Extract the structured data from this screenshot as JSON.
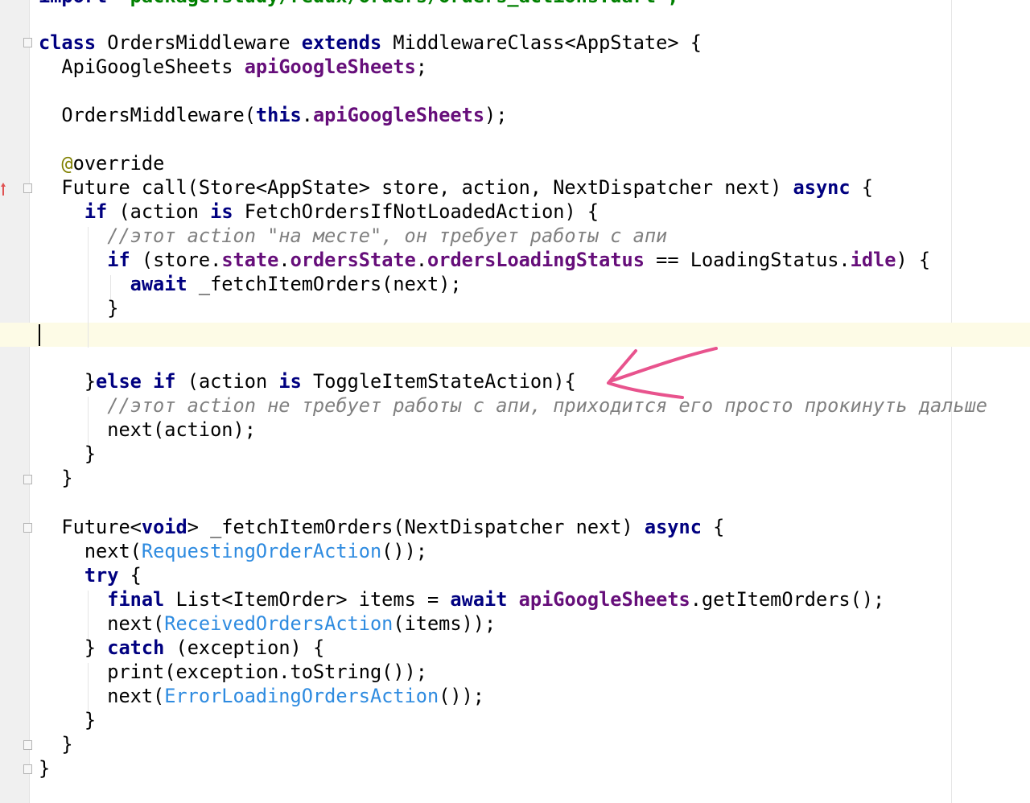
{
  "editor": {
    "lines": [
      [
        "import",
        "'package:study/redux/orders/orders_actions.dart';"
      ],
      [
        "class",
        "OrdersMiddleware",
        "extends",
        "MiddlewareClass<AppState> {"
      ],
      [
        "ApiGoogleSheets",
        "apiGoogleSheets",
        ";"
      ],
      [
        "OrdersMiddleware(",
        "this",
        ".",
        "apiGoogleSheets",
        ");"
      ],
      [
        "@",
        "override"
      ],
      [
        "Future call(Store<AppState> store, action, NextDispatcher next)",
        "async",
        "{"
      ],
      [
        "if",
        "(action",
        "is",
        "FetchOrdersIfNotLoadedAction) {"
      ],
      [
        "//этот action \"на месте\", он требует работы с апи"
      ],
      [
        "if",
        "(store.",
        "state",
        ".",
        "ordersState",
        ".",
        "ordersLoadingStatus",
        "== LoadingStatus.",
        "idle",
        ") {"
      ],
      [
        "await",
        "_fetchItemOrders(next);"
      ],
      [
        "}"
      ],
      [
        "}",
        "else",
        "if",
        "(action",
        "is",
        "ToggleItemStateAction){"
      ],
      [
        "//этот action не требует работы с апи, приходится его просто прокинуть дальше"
      ],
      [
        "next(action);"
      ],
      [
        "}"
      ],
      [
        "}"
      ],
      [
        "Future<",
        "void",
        "> _fetchItemOrders(NextDispatcher next)",
        "async",
        "{"
      ],
      [
        "next(",
        "RequestingOrderAction",
        "());"
      ],
      [
        "try",
        "{"
      ],
      [
        "final",
        "List<ItemOrder> items =",
        "await",
        "apiGoogleSheets",
        ".getItemOrders();"
      ],
      [
        "next(",
        "ReceivedOrdersAction",
        "(items));"
      ],
      [
        "}",
        "catch",
        "(exception) {"
      ],
      [
        "print(exception.toString());"
      ],
      [
        "next(",
        "ErrorLoadingOrdersAction",
        "());"
      ],
      [
        "}"
      ],
      [
        "}"
      ],
      [
        "}"
      ]
    ]
  },
  "colors": {
    "keyword": "#000080",
    "field": "#660e7a",
    "class_ref": "#2e8be0",
    "comment": "#808080",
    "annotation": "#808000",
    "caret_row": "#fdfbe6",
    "arrow": "#e8538d"
  },
  "icons": [
    "fold-icon",
    "override-marker-icon",
    "hand-drawn-arrow-icon"
  ]
}
